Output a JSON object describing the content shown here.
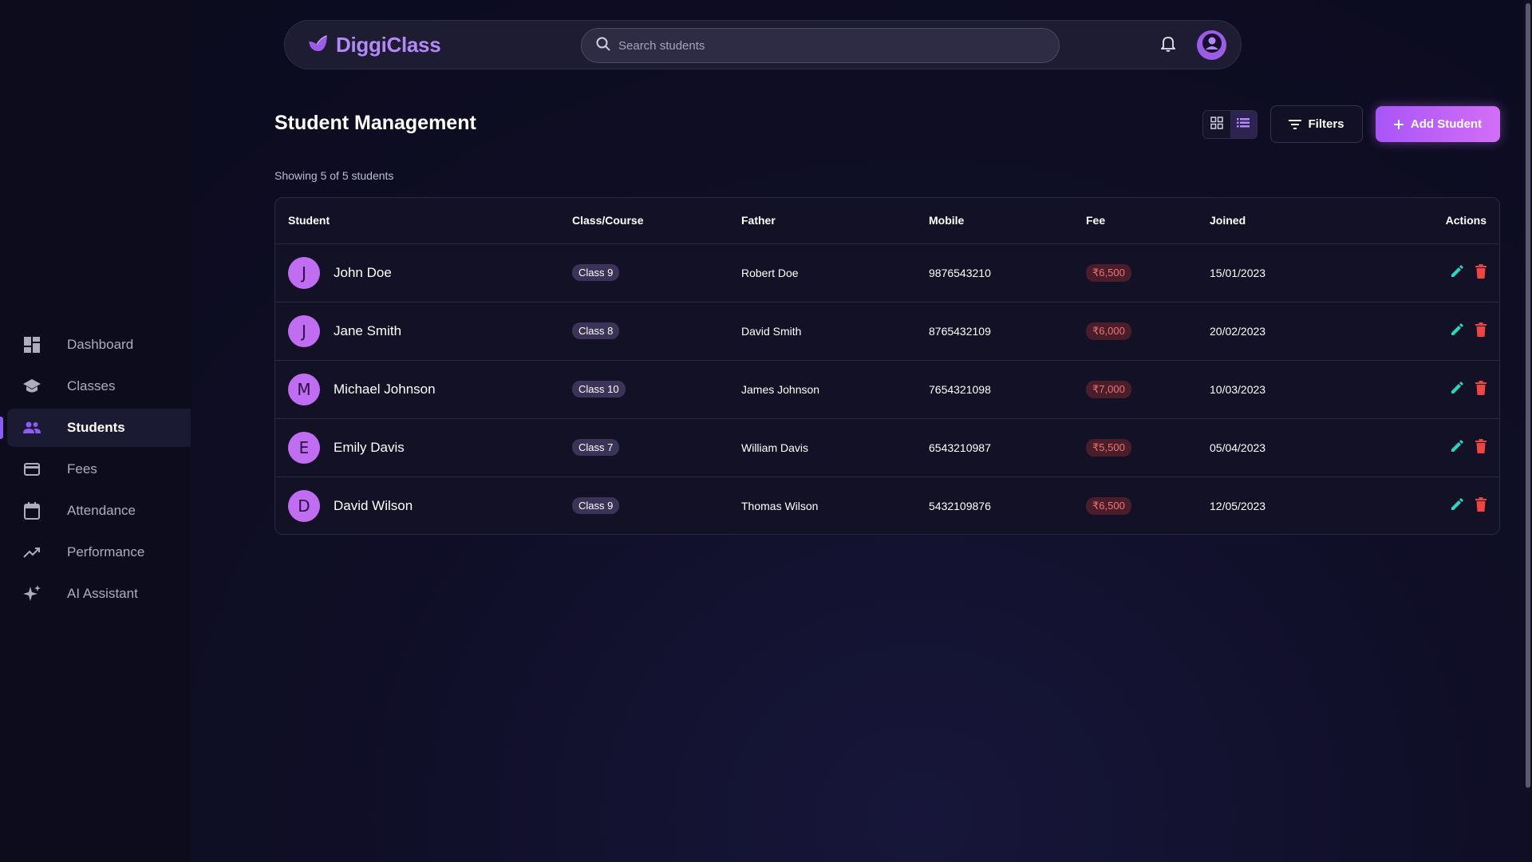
{
  "app": {
    "name": "DiggiClass"
  },
  "search": {
    "placeholder": "Search students"
  },
  "sidebar": {
    "items": [
      {
        "label": "Dashboard",
        "icon": "dashboard-icon"
      },
      {
        "label": "Classes",
        "icon": "graduation-cap-icon"
      },
      {
        "label": "Students",
        "icon": "people-icon",
        "active": true
      },
      {
        "label": "Fees",
        "icon": "credit-card-icon"
      },
      {
        "label": "Attendance",
        "icon": "calendar-icon"
      },
      {
        "label": "Performance",
        "icon": "trending-up-icon"
      },
      {
        "label": "AI Assistant",
        "icon": "sparkles-icon"
      }
    ]
  },
  "main": {
    "title": "Student Management",
    "filters_label": "Filters",
    "add_label": "Add Student",
    "showing": "Showing 5 of 5 students",
    "view_mode": "list"
  },
  "table": {
    "headers": [
      "Student",
      "Class/Course",
      "Father",
      "Mobile",
      "Fee",
      "Joined",
      "Actions"
    ],
    "rows": [
      {
        "initial": "J",
        "name": "John Doe",
        "class": "Class 9",
        "father": "Robert Doe",
        "mobile": "9876543210",
        "fee": "₹6,500",
        "joined": "15/01/2023"
      },
      {
        "initial": "J",
        "name": "Jane Smith",
        "class": "Class 8",
        "father": "David Smith",
        "mobile": "8765432109",
        "fee": "₹6,000",
        "joined": "20/02/2023"
      },
      {
        "initial": "M",
        "name": "Michael Johnson",
        "class": "Class 10",
        "father": "James Johnson",
        "mobile": "7654321098",
        "fee": "₹7,000",
        "joined": "10/03/2023"
      },
      {
        "initial": "E",
        "name": "Emily Davis",
        "class": "Class 7",
        "father": "William Davis",
        "mobile": "6543210987",
        "fee": "₹5,500",
        "joined": "05/04/2023"
      },
      {
        "initial": "D",
        "name": "David Wilson",
        "class": "Class 9",
        "father": "Thomas Wilson",
        "mobile": "5432109876",
        "fee": "₹6,500",
        "joined": "12/05/2023"
      }
    ]
  },
  "colors": {
    "accent": "#a855f7",
    "brand": "#b28af5",
    "edit": "#2dd4bf",
    "delete": "#ef4444",
    "fee_text": "#f07373"
  }
}
